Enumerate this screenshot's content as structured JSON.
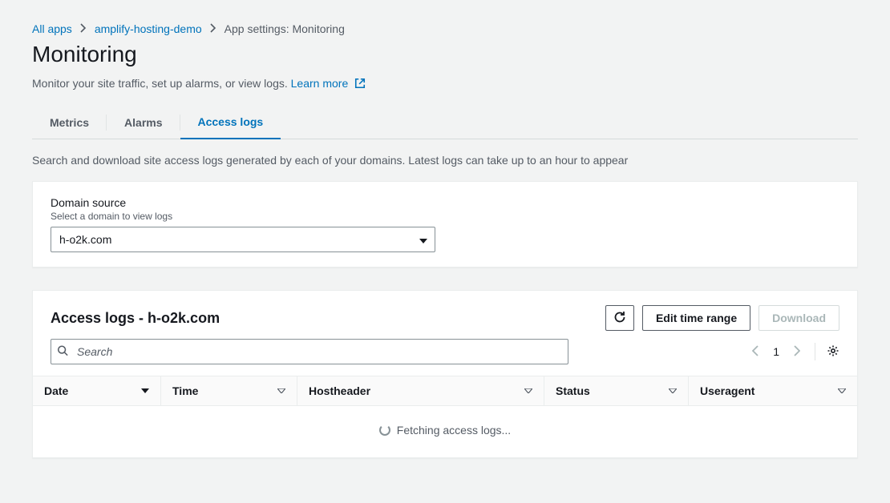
{
  "breadcrumb": {
    "items": [
      {
        "label": "All apps",
        "href": true
      },
      {
        "label": "amplify-hosting-demo",
        "href": true
      },
      {
        "label": "App settings: Monitoring",
        "href": false
      }
    ]
  },
  "page": {
    "title": "Monitoring",
    "subtitle_prefix": "Monitor your site traffic, set up alarms, or view logs. ",
    "learn_more": "Learn more"
  },
  "tabs": [
    {
      "label": "Metrics",
      "active": false
    },
    {
      "label": "Alarms",
      "active": false
    },
    {
      "label": "Access logs",
      "active": true
    }
  ],
  "access_logs_helper": "Search and download site access logs generated by each of your domains. Latest logs can take up to an hour to appear",
  "domain_source": {
    "label": "Domain source",
    "hint": "Select a domain to view logs",
    "selected": "h-o2k.com"
  },
  "logs": {
    "title": "Access logs - h-o2k.com",
    "buttons": {
      "refresh_aria": "Refresh",
      "edit_range": "Edit time range",
      "download": "Download"
    },
    "search_placeholder": "Search",
    "pager": {
      "page": "1"
    },
    "columns": {
      "date": "Date",
      "time": "Time",
      "host": "Hostheader",
      "status": "Status",
      "ua": "Useragent"
    },
    "loading_text": "Fetching access logs..."
  }
}
